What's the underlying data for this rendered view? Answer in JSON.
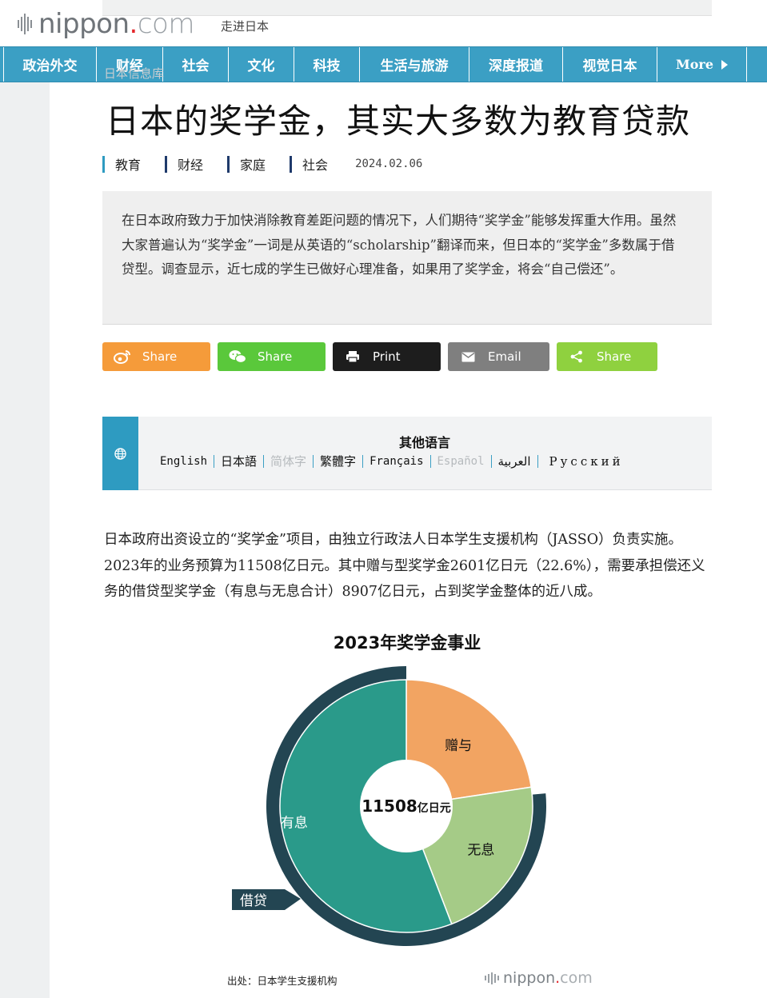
{
  "header": {
    "logo_main": "nippon",
    "logo_dot": ".",
    "logo_com": "com",
    "tagline": "走进日本"
  },
  "nav": {
    "items": [
      "政治外交",
      "财经",
      "社会",
      "文化",
      "科技",
      "生活与旅游",
      "深度报道",
      "视觉日本"
    ],
    "more": "More"
  },
  "breadcrumb_ghost": "日本信息库",
  "article": {
    "title": "日本的奖学金，其实大多数为教育贷款",
    "tags": [
      {
        "label": "教育",
        "color": "#2e9bc1"
      },
      {
        "label": "财经",
        "color": "#1f3a6b"
      },
      {
        "label": "家庭",
        "color": "#1f3a6b"
      },
      {
        "label": "社会",
        "color": "#1f3a6b"
      }
    ],
    "date": "2024.02.06",
    "summary": "在日本政府致力于加快消除教育差距问题的情况下，人们期待“奖学金”能够发挥重大作用。虽然大家普遍认为“奖学金”一词是从英语的“scholarship”翻译而来，但日本的“奖学金”多数属于借贷型。调查显示，近七成的学生已做好心理准备，如果用了奖学金，将会“自己偿还”。",
    "body": "日本政府出资设立的“奖学金”项目，由独立行政法人日本学生支援机构（JASSO）负责实施。2023年的业务预算为11508亿日元。其中赠与型奖学金2601亿日元（22.6%），需要承担偿还义务的借贷型奖学金（有息与无息合计）8907亿日元，占到奖学金整体的近八成。"
  },
  "share": {
    "buttons": [
      {
        "label": "Share",
        "icon": "weibo-icon",
        "color": "#f59b3a"
      },
      {
        "label": "Share",
        "icon": "wechat-icon",
        "color": "#5ac83b"
      },
      {
        "label": "Print",
        "icon": "printer-icon",
        "color": "#1d1d1d"
      },
      {
        "label": "Email",
        "icon": "mail-icon",
        "color": "#7f7f7f"
      },
      {
        "label": "Share",
        "icon": "share-icon",
        "color": "#8fd13f"
      }
    ]
  },
  "languages": {
    "title": "其他语言",
    "items": [
      "English",
      "日本語",
      "简体字",
      "繁體字",
      "Français",
      "Español",
      "العربية",
      "Русский"
    ]
  },
  "chart_data": {
    "type": "pie",
    "title": "2023年奖学金事业",
    "center_value": "11508",
    "center_unit": "亿日元",
    "slices": [
      {
        "name": "赠与",
        "value": 2601,
        "color": "#f2a462"
      },
      {
        "name": "无息",
        "value": 2480,
        "color": "#a5cb87"
      },
      {
        "name": "有息",
        "value": 6427,
        "color": "#2a9a8a"
      }
    ],
    "outer_ring": {
      "name": "借贷",
      "value": 8907,
      "color": "#234552"
    },
    "source": "出处：日本学生支援机构",
    "watermark_main": "nippon",
    "watermark_dot": ".",
    "watermark_com": "com"
  }
}
